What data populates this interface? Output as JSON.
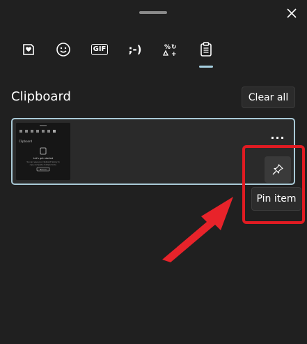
{
  "tabs": [
    {
      "name": "kaomoji-favorites",
      "icon": "heart-sticker-icon"
    },
    {
      "name": "emoji",
      "icon": "smiley-icon"
    },
    {
      "name": "gif",
      "icon": "gif-icon",
      "label": "GIF"
    },
    {
      "name": "kaomoji",
      "icon": "kaomoji-icon",
      "label": ";-)"
    },
    {
      "name": "symbols",
      "icon": "symbols-icon"
    },
    {
      "name": "clipboard",
      "icon": "clipboard-icon",
      "active": true
    }
  ],
  "clipboard": {
    "title": "Clipboard",
    "clear_all_label": "Clear all",
    "item": {
      "thumbnail": {
        "section": "Clipboard",
        "heading": "Let's get started",
        "line1": "You can view your clipboard history to",
        "line2": "copy and paste multiple items.",
        "button": "Turn on"
      }
    },
    "more_label": "...",
    "pin_tooltip": "Pin item"
  },
  "colors": {
    "background": "#202020",
    "accent": "#a9c9d6",
    "highlight": "#e01b22"
  }
}
